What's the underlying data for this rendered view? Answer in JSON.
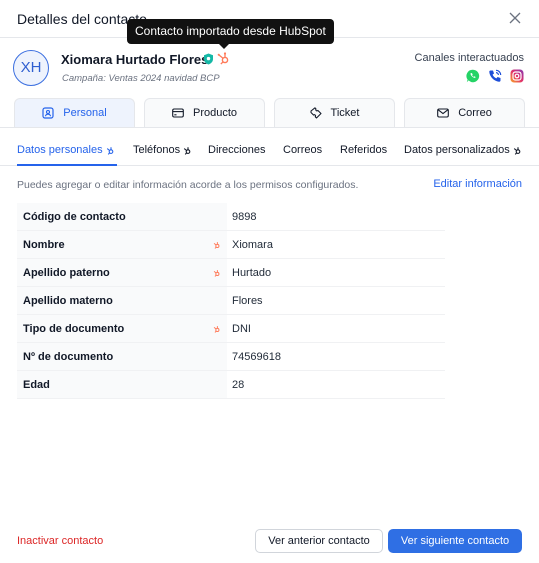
{
  "modal": {
    "title": "Detalles del contacto"
  },
  "tooltip": {
    "text": "Contacto importado desde HubSpot"
  },
  "contact": {
    "initials": "XH",
    "name": "Xiomara Hurtado Flores",
    "campaign": "Campaña: Ventas 2024 navidad BCP"
  },
  "channels": {
    "label": "Canales interactuados",
    "icons": [
      "whatsapp-icon",
      "phone-call-icon",
      "instagram-icon"
    ],
    "colors": {
      "whatsapp": "#25d366",
      "phone": "#1d4ed8",
      "instagram": "#e1306c"
    }
  },
  "cards": [
    {
      "label": "Personal",
      "icon": "id-card-icon"
    },
    {
      "label": "Producto",
      "icon": "credit-card-icon"
    },
    {
      "label": "Ticket",
      "icon": "ticket-icon"
    },
    {
      "label": "Correo",
      "icon": "mail-icon"
    }
  ],
  "subtabs": [
    "Datos personales",
    "Teléfonos",
    "Direcciones",
    "Correos",
    "Referidos",
    "Datos personalizados"
  ],
  "info": {
    "text": "Puedes agregar o editar información acorde a los permisos configurados.",
    "edit_link": "Editar información"
  },
  "fields": [
    {
      "label": "Código de contacto",
      "value": "9898",
      "hubspot": false
    },
    {
      "label": "Nombre",
      "value": "Xiomara",
      "hubspot": true
    },
    {
      "label": "Apellido paterno",
      "value": "Hurtado",
      "hubspot": true
    },
    {
      "label": "Apellido materno",
      "value": "Flores",
      "hubspot": false
    },
    {
      "label": "Tipo de documento",
      "value": "DNI",
      "hubspot": true
    },
    {
      "label": "Nº de documento",
      "value": "74569618",
      "hubspot": false
    },
    {
      "label": "Edad",
      "value": "28",
      "hubspot": false
    }
  ],
  "footer": {
    "deactivate": "Inactivar contacto",
    "prev": "Ver anterior contacto",
    "next": "Ver siguiente contacto"
  },
  "colors": {
    "accent": "#2563eb",
    "danger": "#dc2626",
    "hubspot": "#ff7a59"
  }
}
